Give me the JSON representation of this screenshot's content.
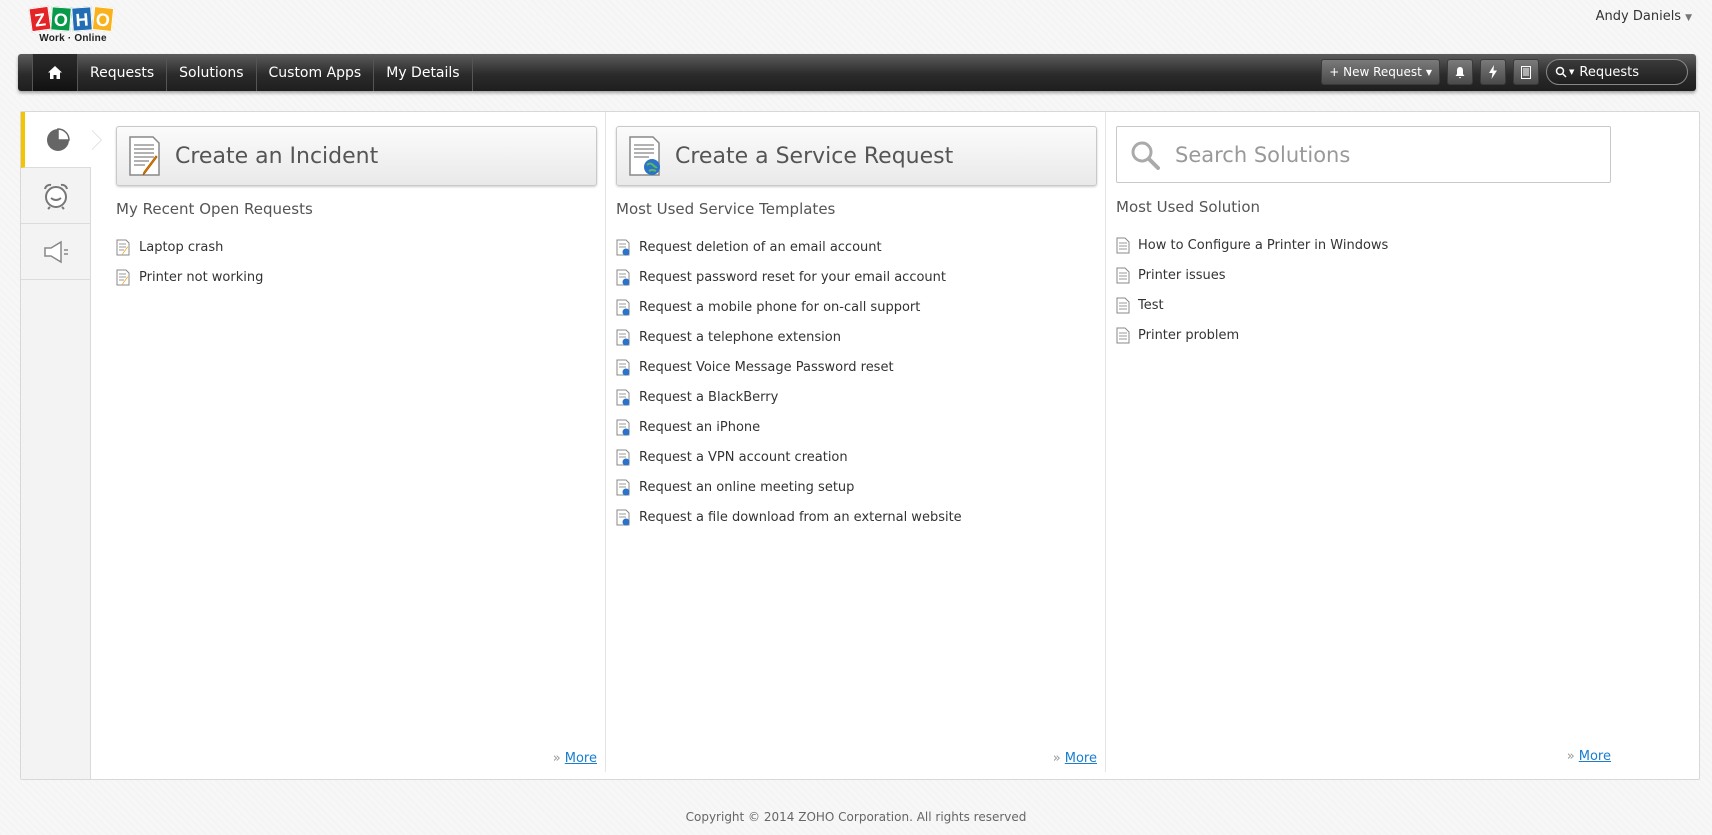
{
  "logo": {
    "letters": [
      "Z",
      "O",
      "H",
      "O"
    ],
    "subtitle": "Work · Online"
  },
  "user": {
    "name": "Andy Daniels"
  },
  "nav": {
    "home_icon": "home-icon",
    "items": [
      {
        "label": "Requests"
      },
      {
        "label": "Solutions"
      },
      {
        "label": "Custom Apps"
      },
      {
        "label": "My Details"
      }
    ],
    "new_request_label": "+ New Request",
    "search_scope": "Requests"
  },
  "sidebar": {
    "tabs": [
      {
        "icon": "pie-chart-icon",
        "active": true
      },
      {
        "icon": "alarm-clock-icon",
        "active": false
      },
      {
        "icon": "megaphone-icon",
        "active": false
      }
    ]
  },
  "incident": {
    "button_label": "Create an Incident",
    "section_title": "My Recent Open Requests",
    "items": [
      {
        "label": "Laptop crash"
      },
      {
        "label": "Printer not working"
      }
    ],
    "more_label": "More"
  },
  "service": {
    "button_label": "Create a Service Request",
    "section_title": "Most Used Service Templates",
    "items": [
      {
        "label": "Request deletion of an email account"
      },
      {
        "label": "Request password reset for your email account"
      },
      {
        "label": "Request a mobile phone for on-call support"
      },
      {
        "label": "Request a telephone extension"
      },
      {
        "label": "Request Voice Message Password reset"
      },
      {
        "label": "Request a BlackBerry"
      },
      {
        "label": "Request an iPhone"
      },
      {
        "label": "Request a VPN account creation"
      },
      {
        "label": "Request an online meeting setup"
      },
      {
        "label": "Request a file download from an external website"
      }
    ],
    "more_label": "More"
  },
  "solutions": {
    "search_placeholder": "Search Solutions",
    "section_title": "Most Used Solution",
    "items": [
      {
        "label": "How to Configure a Printer in Windows"
      },
      {
        "label": "Printer issues"
      },
      {
        "label": "Test"
      },
      {
        "label": "Printer problem"
      }
    ],
    "more_label": "More"
  },
  "footer": {
    "copyright": "Copyright © 2014 ZOHO Corporation. All rights reserved"
  },
  "colors": {
    "accent": "#f5c400",
    "link": "#1a7ed0",
    "navbar": "#2b2b2b"
  }
}
